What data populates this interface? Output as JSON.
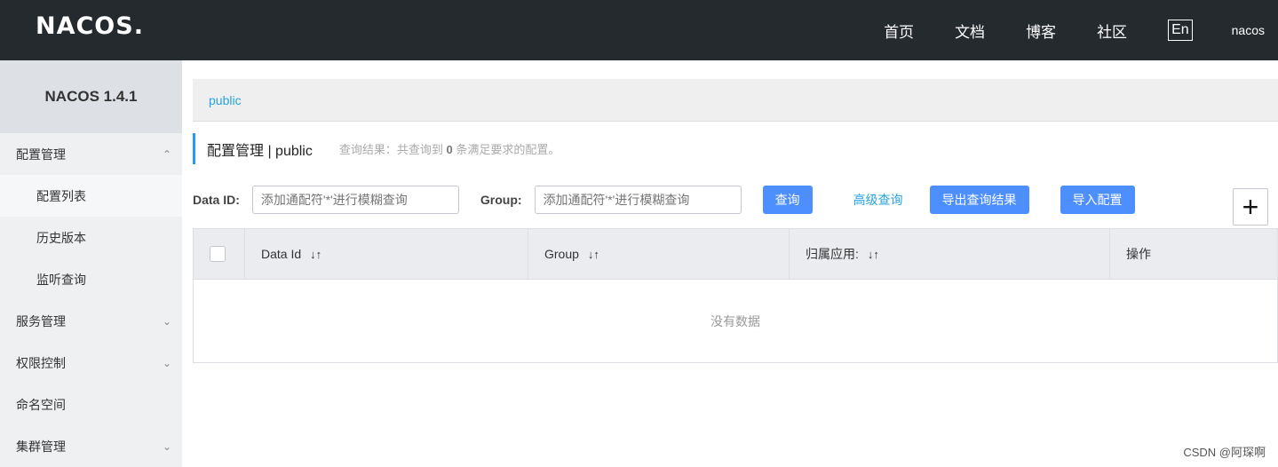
{
  "header": {
    "logo": "NACOS.",
    "nav": [
      "首页",
      "文档",
      "博客",
      "社区"
    ],
    "lang": "En",
    "user": "nacos"
  },
  "sidebar": {
    "version": "NACOS 1.4.1",
    "items": [
      {
        "label": "配置管理",
        "chevron": "up"
      },
      {
        "label": "配置列表",
        "sub": true,
        "active": true
      },
      {
        "label": "历史版本",
        "sub": true
      },
      {
        "label": "监听查询",
        "sub": true
      },
      {
        "label": "服务管理",
        "chevron": "down"
      },
      {
        "label": "权限控制",
        "chevron": "down"
      },
      {
        "label": "命名空间"
      },
      {
        "label": "集群管理",
        "chevron": "down"
      }
    ]
  },
  "namespace": {
    "current": "public"
  },
  "title": {
    "main": "配置管理 | public",
    "summary_prefix": "查询结果：共查询到",
    "count": "0",
    "summary_suffix": "条满足要求的配置。"
  },
  "filter": {
    "dataid_label": "Data ID:",
    "dataid_placeholder": "添加通配符'*'进行模糊查询",
    "group_label": "Group:",
    "group_placeholder": "添加通配符'*'进行模糊查询",
    "query_btn": "查询",
    "advanced": "高级查询",
    "export": "导出查询结果",
    "import": "导入配置",
    "add": "+"
  },
  "table": {
    "columns": [
      "Data Id",
      "Group",
      "归属应用:",
      "操作"
    ],
    "sort_icon": "↓↑",
    "empty": "没有数据"
  },
  "watermark": "CSDN @阿琛啊"
}
